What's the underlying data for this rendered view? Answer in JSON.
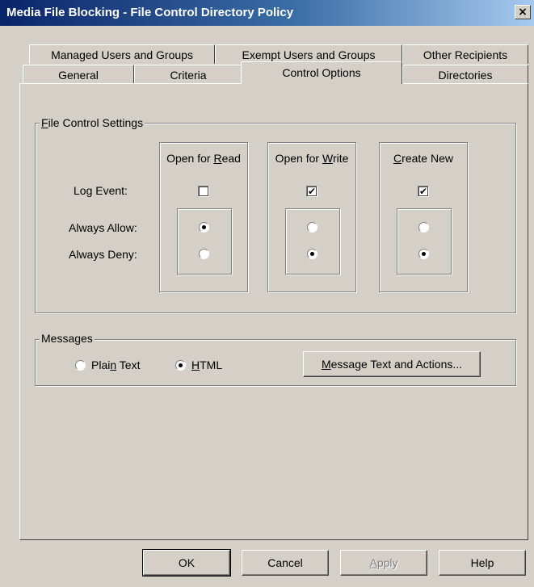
{
  "window": {
    "title": "Media File Blocking - File Control Directory Policy",
    "close": "×"
  },
  "tabs_back": [
    {
      "label": "Managed Users and Groups"
    },
    {
      "label": "Exempt Users and Groups"
    },
    {
      "label": "Other Recipients"
    }
  ],
  "tabs_front": [
    {
      "label": "General"
    },
    {
      "label": "Criteria"
    },
    {
      "label": "Control Options"
    },
    {
      "label": "Directories"
    }
  ],
  "settings": {
    "group": "ile Control Settings",
    "group_ul": "F",
    "row_labels": {
      "log": "Log Event:",
      "allow": "Always Allow:",
      "deny": "Always Deny:"
    },
    "columns": [
      {
        "pre": "Open for ",
        "ul": "R",
        "post": "ead",
        "log": false,
        "mode": "allow"
      },
      {
        "pre": "Open for ",
        "ul": "W",
        "post": "rite",
        "log": true,
        "mode": "deny"
      },
      {
        "pre": "",
        "ul": "C",
        "post": "reate New",
        "log": true,
        "mode": "deny"
      }
    ]
  },
  "messages": {
    "group": "Messages",
    "plain": {
      "pre": "Plai",
      "ul": "n",
      "post": " Text"
    },
    "html": {
      "pre": "",
      "ul": "H",
      "post": "TML"
    },
    "selected": "HTML",
    "button": {
      "ul": "M",
      "post": "essage Text and Actions..."
    }
  },
  "buttons": {
    "ok": "OK",
    "cancel": "Cancel",
    "apply": {
      "ul": "A",
      "post": "pply"
    },
    "help": "Help"
  },
  "check_glyph": "✔"
}
